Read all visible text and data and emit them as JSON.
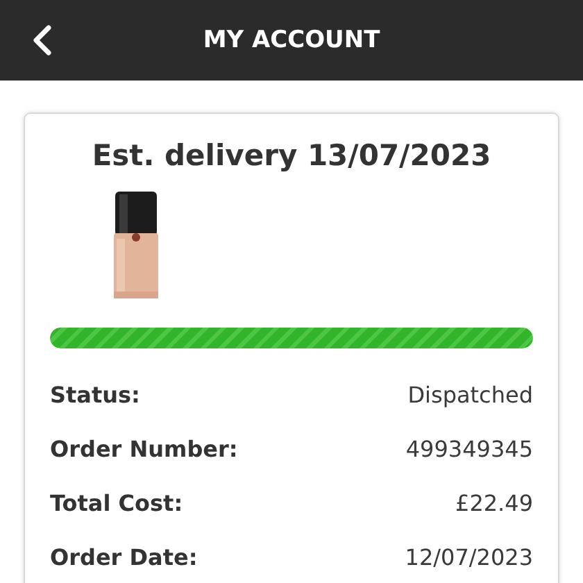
{
  "header": {
    "title": "MY ACCOUNT"
  },
  "order": {
    "title": "Est. delivery 13/07/2023",
    "progress": {
      "level": 1
    },
    "details": [
      {
        "label": "Status:",
        "value": "Dispatched"
      },
      {
        "label": "Order Number:",
        "value": "499349345"
      },
      {
        "label": "Total Cost:",
        "value": "£22.49"
      },
      {
        "label": "Order Date:",
        "value": "12/07/2023"
      }
    ]
  }
}
